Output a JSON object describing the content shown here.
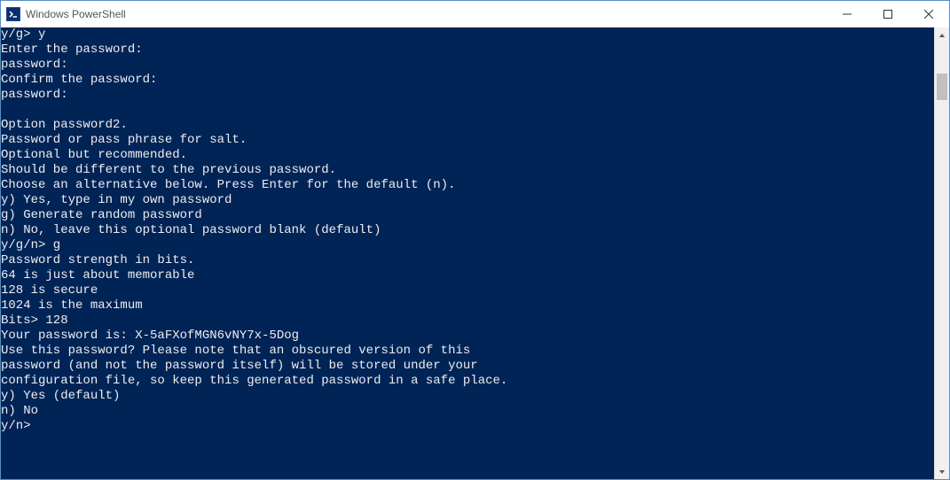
{
  "titlebar": {
    "title": "Windows PowerShell"
  },
  "console": {
    "lines": [
      "y/g> y",
      "Enter the password:",
      "password:",
      "Confirm the password:",
      "password:",
      "",
      "Option password2.",
      "Password or pass phrase for salt.",
      "Optional but recommended.",
      "Should be different to the previous password.",
      "Choose an alternative below. Press Enter for the default (n).",
      "y) Yes, type in my own password",
      "g) Generate random password",
      "n) No, leave this optional password blank (default)",
      "y/g/n> g",
      "Password strength in bits.",
      "64 is just about memorable",
      "128 is secure",
      "1024 is the maximum",
      "Bits> 128",
      "Your password is: X-5aFXofMGN6vNY7x-5Dog",
      "Use this password? Please note that an obscured version of this",
      "password (and not the password itself) will be stored under your",
      "configuration file, so keep this generated password in a safe place.",
      "y) Yes (default)",
      "n) No",
      "y/n>"
    ]
  }
}
